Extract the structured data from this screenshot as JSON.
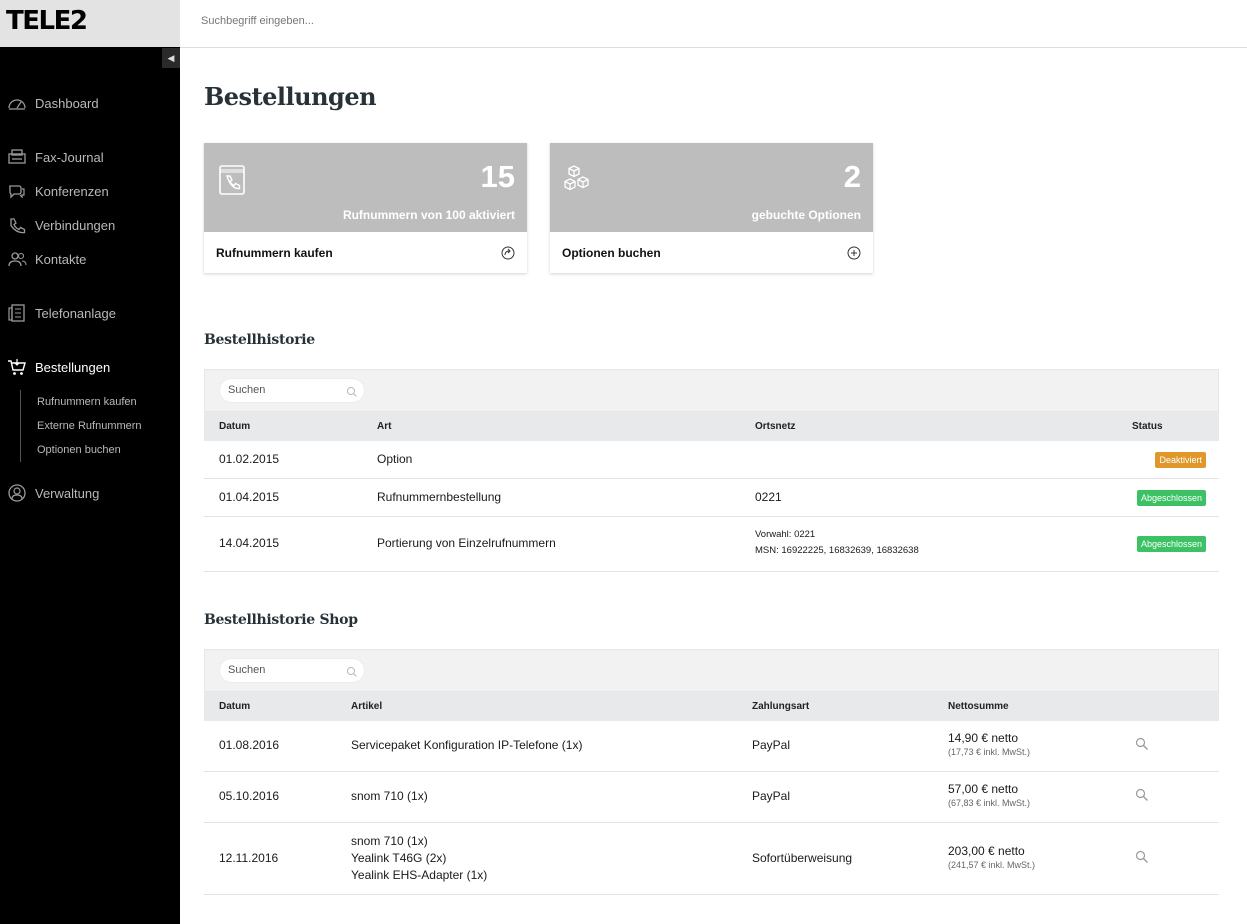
{
  "brand": {
    "logo_text": "TELE2"
  },
  "topbar": {
    "search_placeholder": "Suchbegriff eingeben..."
  },
  "sidebar": {
    "items": [
      {
        "label": "Dashboard"
      },
      {
        "label": "Fax-Journal"
      },
      {
        "label": "Konferenzen"
      },
      {
        "label": "Verbindungen"
      },
      {
        "label": "Kontakte"
      },
      {
        "label": "Telefonanlage"
      },
      {
        "label": "Bestellungen",
        "active": true
      },
      {
        "label": "Verwaltung"
      }
    ],
    "subitems": [
      {
        "label": "Rufnummern kaufen"
      },
      {
        "label": "Externe Rufnummern"
      },
      {
        "label": "Optionen buchen"
      }
    ]
  },
  "page": {
    "title": "Bestellungen"
  },
  "cards": [
    {
      "number": "15",
      "caption": "Rufnummern von 100 aktiviert",
      "action": "Rufnummern kaufen"
    },
    {
      "number": "2",
      "caption": "gebuchte Optionen",
      "action": "Optionen buchen"
    }
  ],
  "history": {
    "title": "Bestellhistorie",
    "search_placeholder": "Suchen",
    "columns": [
      "Datum",
      "Art",
      "Ortsnetz",
      "Status"
    ],
    "rows": [
      {
        "datum": "01.02.2015",
        "art": "Option",
        "ortsnetz": "",
        "status": "Deaktiviert",
        "status_color": "#e0982a"
      },
      {
        "datum": "01.04.2015",
        "art": "Rufnummernbestellung",
        "ortsnetz": "0221",
        "status": "Abgeschlossen",
        "status_color": "#3cc265"
      },
      {
        "datum": "14.04.2015",
        "art": "Portierung von Einzelrufnummern",
        "ortsnetz_line1": "Vorwahl: 0221",
        "ortsnetz_line2": "MSN: 16922225, 16832639, 16832638",
        "status": "Abgeschlossen",
        "status_color": "#3cc265"
      }
    ]
  },
  "shop": {
    "title": "Bestellhistorie Shop",
    "search_placeholder": "Suchen",
    "columns": [
      "Datum",
      "Artikel",
      "Zahlungsart",
      "Nettosumme"
    ],
    "rows": [
      {
        "datum": "01.08.2016",
        "artikel": [
          "Servicepaket Konfiguration IP-Telefone (1x)"
        ],
        "zahlungsart": "PayPal",
        "netto": "14,90 € netto",
        "brutto": "(17,73 € inkl. MwSt.)"
      },
      {
        "datum": "05.10.2016",
        "artikel": [
          "snom 710 (1x)"
        ],
        "zahlungsart": "PayPal",
        "netto": "57,00 € netto",
        "brutto": "(67,83 € inkl. MwSt.)"
      },
      {
        "datum": "12.11.2016",
        "artikel": [
          "snom 710 (1x)",
          "Yealink T46G (2x)",
          "Yealink EHS-Adapter (1x)"
        ],
        "zahlungsart": "Sofortüberweisung",
        "netto": "203,00 € netto",
        "brutto": "(241,57 € inkl. MwSt.)"
      }
    ]
  },
  "icons": [
    "dashboard-icon",
    "fax-icon",
    "conference-icon",
    "phone-icon",
    "contacts-icon",
    "pbx-icon",
    "cart-icon",
    "admin-icon",
    "search-icon",
    "phonebook-icon",
    "boxes-icon",
    "forward-icon",
    "plus-icon"
  ],
  "colors": {
    "sidebar_bg": "#000000",
    "card_top": "#bdbdbd",
    "badge_orange": "#e0982a",
    "badge_green": "#3cc265",
    "title_color": "#263238"
  }
}
